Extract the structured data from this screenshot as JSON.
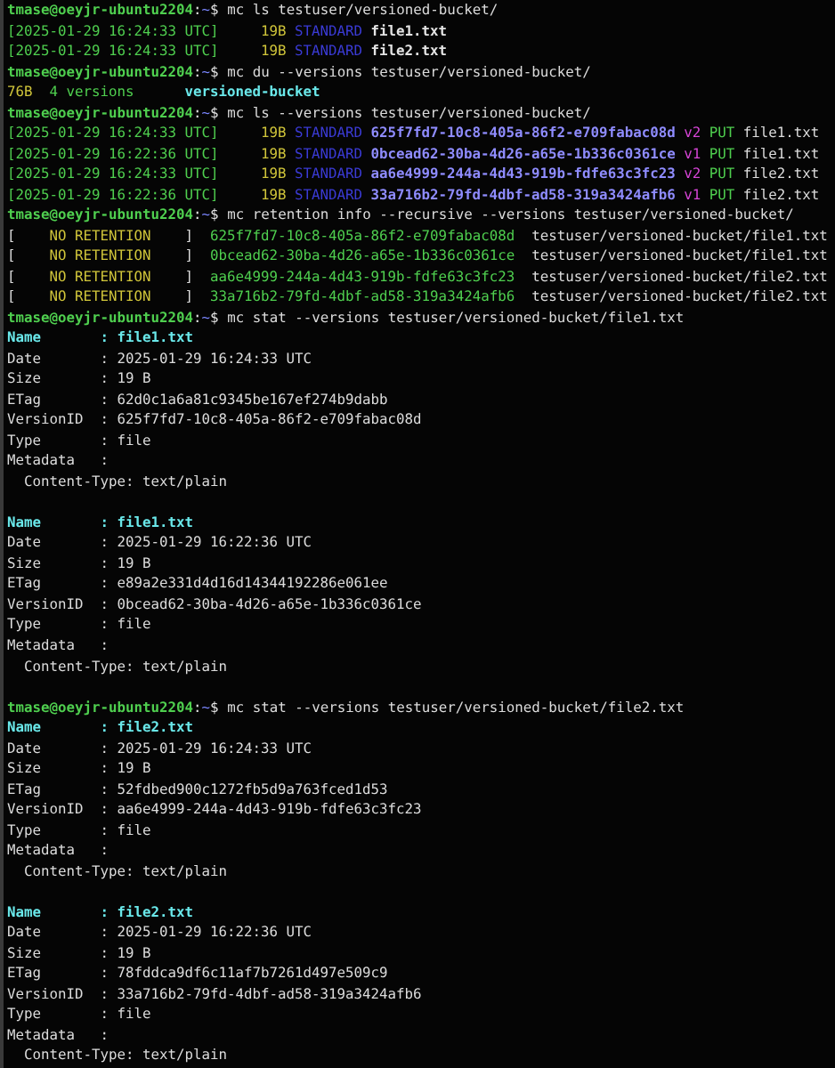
{
  "terminal": {
    "lines": [
      {
        "kind": "prompt",
        "host": "tmase@oeyjr-ubuntu2204",
        "sep": ":",
        "path": "~",
        "sign": "$",
        "command": "mc ls testuser/versioned-bucket/"
      },
      {
        "kind": "ls",
        "date": "[2025-01-29 16:24:33 UTC]",
        "size": "19B",
        "storage": "STANDARD",
        "name": "file1.txt"
      },
      {
        "kind": "ls",
        "date": "[2025-01-29 16:24:33 UTC]",
        "size": "19B",
        "storage": "STANDARD",
        "name": "file2.txt"
      },
      {
        "kind": "prompt",
        "host": "tmase@oeyjr-ubuntu2204",
        "sep": ":",
        "path": "~",
        "sign": "$",
        "command": "mc du --versions testuser/versioned-bucket/"
      },
      {
        "kind": "du",
        "size": "76B",
        "count": "4 versions",
        "name": "versioned-bucket"
      },
      {
        "kind": "prompt",
        "host": "tmase@oeyjr-ubuntu2204",
        "sep": ":",
        "path": "~",
        "sign": "$",
        "command": "mc ls --versions testuser/versioned-bucket/"
      },
      {
        "kind": "version",
        "date": "[2025-01-29 16:24:33 UTC]",
        "size": "19B",
        "storage": "STANDARD",
        "id": "625f7fd7-10c8-405a-86f2-e709fabac08d",
        "tag": "v2",
        "op": "PUT",
        "name": "file1.txt"
      },
      {
        "kind": "version",
        "date": "[2025-01-29 16:22:36 UTC]",
        "size": "19B",
        "storage": "STANDARD",
        "id": "0bcead62-30ba-4d26-a65e-1b336c0361ce",
        "tag": "v1",
        "op": "PUT",
        "name": "file1.txt"
      },
      {
        "kind": "version",
        "date": "[2025-01-29 16:24:33 UTC]",
        "size": "19B",
        "storage": "STANDARD",
        "id": "aa6e4999-244a-4d43-919b-fdfe63c3fc23",
        "tag": "v2",
        "op": "PUT",
        "name": "file2.txt"
      },
      {
        "kind": "version",
        "date": "[2025-01-29 16:22:36 UTC]",
        "size": "19B",
        "storage": "STANDARD",
        "id": "33a716b2-79fd-4dbf-ad58-319a3424afb6",
        "tag": "v1",
        "op": "PUT",
        "name": "file2.txt"
      },
      {
        "kind": "prompt",
        "host": "tmase@oeyjr-ubuntu2204",
        "sep": ":",
        "path": "~",
        "sign": "$",
        "command": "mc retention info --recursive --versions testuser/versioned-bucket/"
      },
      {
        "kind": "retention",
        "open": "[",
        "status": "NO RETENTION",
        "close": "]",
        "id": "625f7fd7-10c8-405a-86f2-e709fabac08d",
        "path": "testuser/versioned-bucket/file1.txt"
      },
      {
        "kind": "retention",
        "open": "[",
        "status": "NO RETENTION",
        "close": "]",
        "id": "0bcead62-30ba-4d26-a65e-1b336c0361ce",
        "path": "testuser/versioned-bucket/file1.txt"
      },
      {
        "kind": "retention",
        "open": "[",
        "status": "NO RETENTION",
        "close": "]",
        "id": "aa6e4999-244a-4d43-919b-fdfe63c3fc23",
        "path": "testuser/versioned-bucket/file2.txt"
      },
      {
        "kind": "retention",
        "open": "[",
        "status": "NO RETENTION",
        "close": "]",
        "id": "33a716b2-79fd-4dbf-ad58-319a3424afb6",
        "path": "testuser/versioned-bucket/file2.txt"
      },
      {
        "kind": "prompt",
        "host": "tmase@oeyjr-ubuntu2204",
        "sep": ":",
        "path": "~",
        "sign": "$",
        "command": "mc stat --versions testuser/versioned-bucket/file1.txt"
      },
      {
        "kind": "field",
        "highlight": true,
        "label": "Name",
        "sep": ":",
        "value": "file1.txt"
      },
      {
        "kind": "field",
        "highlight": false,
        "label": "Date",
        "sep": ":",
        "value": "2025-01-29 16:24:33 UTC"
      },
      {
        "kind": "field",
        "highlight": false,
        "label": "Size",
        "sep": ":",
        "value": "19 B"
      },
      {
        "kind": "field",
        "highlight": false,
        "label": "ETag",
        "sep": ":",
        "value": "62d0c1a6a81c9345be167ef274b9dabb"
      },
      {
        "kind": "field",
        "highlight": false,
        "label": "VersionID",
        "sep": ":",
        "value": "625f7fd7-10c8-405a-86f2-e709fabac08d"
      },
      {
        "kind": "field",
        "highlight": false,
        "label": "Type",
        "sep": ":",
        "value": "file"
      },
      {
        "kind": "field",
        "highlight": false,
        "label": "Metadata",
        "sep": ":"
      },
      {
        "kind": "meta",
        "text": "Content-Type: text/plain"
      },
      {
        "kind": "blank"
      },
      {
        "kind": "field",
        "highlight": true,
        "label": "Name",
        "sep": ":",
        "value": "file1.txt"
      },
      {
        "kind": "field",
        "highlight": false,
        "label": "Date",
        "sep": ":",
        "value": "2025-01-29 16:22:36 UTC"
      },
      {
        "kind": "field",
        "highlight": false,
        "label": "Size",
        "sep": ":",
        "value": "19 B"
      },
      {
        "kind": "field",
        "highlight": false,
        "label": "ETag",
        "sep": ":",
        "value": "e89a2e331d4d16d14344192286e061ee"
      },
      {
        "kind": "field",
        "highlight": false,
        "label": "VersionID",
        "sep": ":",
        "value": "0bcead62-30ba-4d26-a65e-1b336c0361ce"
      },
      {
        "kind": "field",
        "highlight": false,
        "label": "Type",
        "sep": ":",
        "value": "file"
      },
      {
        "kind": "field",
        "highlight": false,
        "label": "Metadata",
        "sep": ":"
      },
      {
        "kind": "meta",
        "text": "Content-Type: text/plain"
      },
      {
        "kind": "blank"
      },
      {
        "kind": "prompt",
        "host": "tmase@oeyjr-ubuntu2204",
        "sep": ":",
        "path": "~",
        "sign": "$",
        "command": "mc stat --versions testuser/versioned-bucket/file2.txt"
      },
      {
        "kind": "field",
        "highlight": true,
        "label": "Name",
        "sep": ":",
        "value": "file2.txt"
      },
      {
        "kind": "field",
        "highlight": false,
        "label": "Date",
        "sep": ":",
        "value": "2025-01-29 16:24:33 UTC"
      },
      {
        "kind": "field",
        "highlight": false,
        "label": "Size",
        "sep": ":",
        "value": "19 B"
      },
      {
        "kind": "field",
        "highlight": false,
        "label": "ETag",
        "sep": ":",
        "value": "52fdbed900c1272fb5d9a763fced1d53"
      },
      {
        "kind": "field",
        "highlight": false,
        "label": "VersionID",
        "sep": ":",
        "value": "aa6e4999-244a-4d43-919b-fdfe63c3fc23"
      },
      {
        "kind": "field",
        "highlight": false,
        "label": "Type",
        "sep": ":",
        "value": "file"
      },
      {
        "kind": "field",
        "highlight": false,
        "label": "Metadata",
        "sep": ":"
      },
      {
        "kind": "meta",
        "text": "Content-Type: text/plain"
      },
      {
        "kind": "blank"
      },
      {
        "kind": "field",
        "highlight": true,
        "label": "Name",
        "sep": ":",
        "value": "file2.txt"
      },
      {
        "kind": "field",
        "highlight": false,
        "label": "Date",
        "sep": ":",
        "value": "2025-01-29 16:22:36 UTC"
      },
      {
        "kind": "field",
        "highlight": false,
        "label": "Size",
        "sep": ":",
        "value": "19 B"
      },
      {
        "kind": "field",
        "highlight": false,
        "label": "ETag",
        "sep": ":",
        "value": "78fddca9df6c11af7b7261d497e509c9"
      },
      {
        "kind": "field",
        "highlight": false,
        "label": "VersionID",
        "sep": ":",
        "value": "33a716b2-79fd-4dbf-ad58-319a3424afb6"
      },
      {
        "kind": "field",
        "highlight": false,
        "label": "Type",
        "sep": ":",
        "value": "file"
      },
      {
        "kind": "field",
        "highlight": false,
        "label": "Metadata",
        "sep": ":"
      },
      {
        "kind": "meta",
        "text": "Content-Type: text/plain"
      }
    ]
  }
}
